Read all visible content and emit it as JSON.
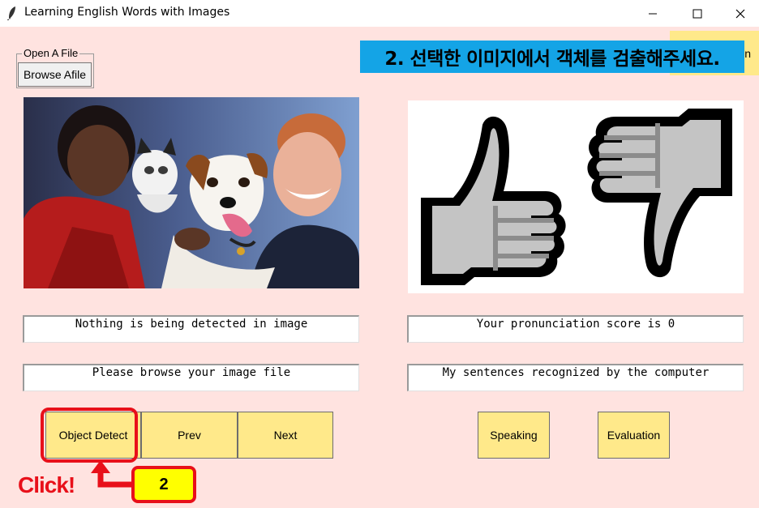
{
  "window": {
    "title": "Learning English Words with Images",
    "controls": [
      "minimize",
      "maximize",
      "close"
    ]
  },
  "file_group": {
    "legend": "Open A File",
    "browse_label": "Browse Afile"
  },
  "banner": {
    "text": "2. 선택한 이미지에서 객체를 검출해주세요.",
    "peek_text": "n"
  },
  "textboxes": {
    "detection_status": "Nothing is being detected in image",
    "image_hint": "Please browse your image file",
    "score": "Your pronunciation score is 0",
    "sentences": "My sentences recognized by the computer"
  },
  "buttons": {
    "object_detect": "Object Detect",
    "prev": "Prev",
    "next": "Next",
    "speaking": "Speaking",
    "evaluation": "Evaluation"
  },
  "annotation": {
    "click_text": "Click!",
    "step_number": "2"
  },
  "colors": {
    "background": "#ffe3e0",
    "button_yellow": "#ffe98a",
    "banner_blue": "#14a4e6",
    "annotation_red": "#e8101a",
    "badge_yellow": "#ffff00"
  },
  "icons": [
    "feather-icon",
    "thumbs-up-icon",
    "thumbs-down-icon"
  ]
}
